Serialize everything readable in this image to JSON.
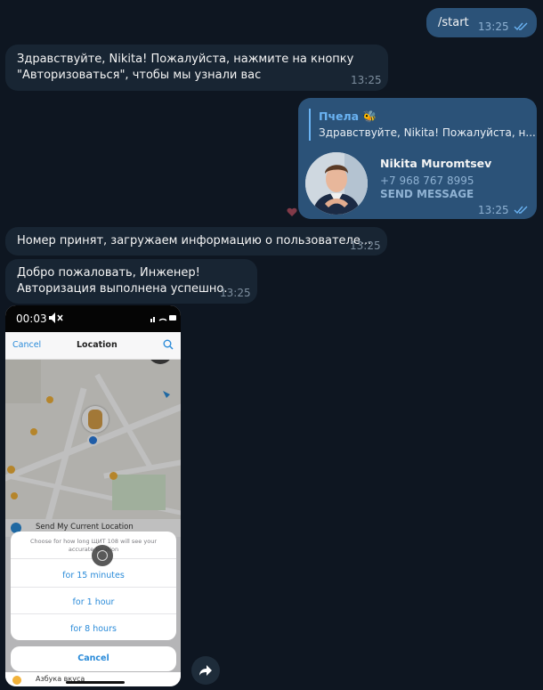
{
  "messages": {
    "start": {
      "text": "/start",
      "time": "13:25"
    },
    "greeting": {
      "line1": "Здравствуйте, Nikita! Пожалуйста, нажмите на кнопку",
      "line2": "\"Авторизоваться\", чтобы мы узнали вас",
      "time": "13:25"
    },
    "contact": {
      "reply_author": "Пчела",
      "reply_emoji": "🐝",
      "reply_text": "Здравствуйте, Nikita! Пожалуйста, н...",
      "name": "Nikita Muromtsev",
      "phone": "+7 968 767 8995",
      "action": "SEND MESSAGE",
      "time": "13:25"
    },
    "number_accepted": {
      "text": "Номер принят, загружаем информацию о пользователе...",
      "time": "13:25"
    },
    "welcome": {
      "line1": "Добро пожаловать, Инженер!",
      "line2": "Авторизация выполнена успешно.",
      "time": "13:25"
    }
  },
  "video": {
    "duration": "00:03",
    "header_cancel": "Cancel",
    "header_title": "Location",
    "send_location": "Send My Current Location",
    "prompt": "Choose for how long ЩИТ 108 will see your accurate location",
    "options": [
      "for 15 minutes",
      "for 1 hour",
      "for 8 hours"
    ],
    "cancel": "Cancel",
    "bottom_item": "Азбука вкуса"
  },
  "colors": {
    "background": "#0e1621",
    "outgoing_bubble": "#2b5278",
    "incoming_bubble": "#182533",
    "accent": "#6ab3f3"
  }
}
